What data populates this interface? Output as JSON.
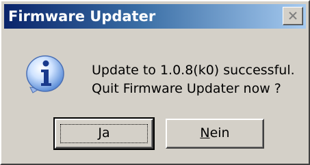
{
  "window": {
    "title": "Firmware Updater",
    "close_icon": "close-icon"
  },
  "dialog": {
    "icon": "info-icon",
    "message_line1": "Update to 1.0.8(k0) successful.",
    "message_line2": "Quit Firmware Updater now ?"
  },
  "buttons": {
    "yes": {
      "label_underlined": "J",
      "label_rest": "a",
      "default": true
    },
    "no": {
      "label_underlined": "N",
      "label_rest": "ein",
      "default": false
    }
  },
  "colors": {
    "titlebar_start": "#0a246a",
    "titlebar_end": "#a6caf0",
    "face": "#d4d0c8"
  }
}
